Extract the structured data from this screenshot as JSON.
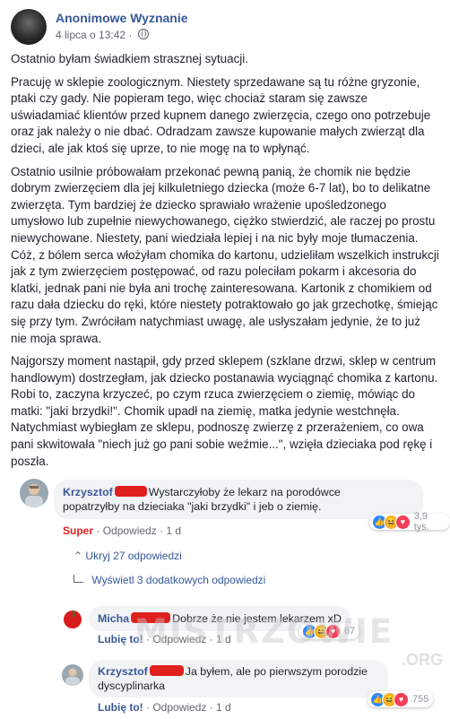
{
  "post": {
    "author": "Anonimowe Wyznanie",
    "date": "4 lipca o 13:42",
    "separator": "·",
    "paragraphs": [
      "Ostatnio byłam świadkiem strasznej sytuacji.",
      "Pracuję w sklepie zoologicznym. Niestety sprzedawane są tu różne gryzonie, ptaki czy gady. Nie popieram tego, więc chociaż staram się zawsze uświadamiać klientów przed kupnem danego zwierzęcia, czego ono potrzebuje oraz jak należy o nie dbać. Odradzam zawsze kupowanie małych zwierząt dla dzieci, ale jak ktoś się uprze, to nie mogę na to wpłynąć.",
      "Ostatnio usilnie próbowałam przekonać pewną panią, że chomik nie będzie dobrym zwierzęciem dla jej kilkuletniego dziecka (może 6-7 lat), bo to delikatne zwierzęta. Tym bardziej że dziecko sprawiało wrażenie upośledzonego umysłowo lub zupełnie niewychowanego, ciężko stwierdzić, ale raczej po prostu niewychowane. Niestety, pani wiedziała lepiej i na nic były moje tłumaczenia. Cóż, z bólem serca włożyłam chomika do kartonu, udzieliłam wszelkich instrukcji jak z tym zwierzęciem postępować, od razu poleciłam pokarm i akcesoria do klatki, jednak pani nie była ani trochę zainteresowana. Kartonik z chomikiem od razu dała dziecku do ręki, które niestety potraktowało go jak grzechotkę, śmiejąc się przy tym. Zwróciłam natychmiast uwagę, ale usłyszałam jedynie, że to już nie moja sprawa.",
      "Najgorszy moment nastąpił, gdy przed sklepem (szklane drzwi, sklep w centrum handlowym) dostrzegłam, jak dziecko postanawia wyciągnąć chomika z kartonu. Robi to, zaczyna krzyczeć, po czym rzuca zwierzęciem o ziemię, mówiąc do matki: \"jaki brzydki!\". Chomik upadł na ziemię, matka jedynie westchnęła. Natychmiast wybiegłam ze sklepu, podnoszę zwierzę z przerażeniem, co owa pani skwitowała \"niech już go pani sobie weźmie...\", wzięła dzieciaka pod rękę i poszła."
    ]
  },
  "comments": {
    "main": {
      "name": "Krzysztof",
      "text_line1": "Wystarczyłoby że lekarz na porodówce",
      "text_line2": "popatrzyłby na dzieciaka \"jaki brzydki\" i jeb o ziemię.",
      "reaction_label": "Super",
      "reply_label": "Odpowiedz",
      "time": "1 d",
      "reaction_count": "3,9 tys."
    },
    "hide_replies": "Ukryj 27 odpowiedzi",
    "show_more": "Wyświetl 3 dodatkowych odpowiedzi",
    "reply1": {
      "name": "Micha",
      "text": "Dobrze że nie jestem lekarzem xD",
      "like_label": "Lubię to!",
      "reply_label": "Odpowiedz",
      "time": "1 d",
      "reaction_count": "67"
    },
    "reply2": {
      "name": "Krzysztof",
      "text_line1": "Ja byłem, ale po pierwszym porodzie",
      "text_line2": "dyscyplinarka",
      "like_label": "Lubię to!",
      "reply_label": "Odpowiedz",
      "time": "1 d",
      "reaction_count": "755"
    }
  },
  "watermark": {
    "main": "MISTRZOWIE",
    "suffix": ".ORG"
  },
  "colors": {
    "link": "#385898",
    "redaction": "#e0201e",
    "bubble": "#f2f3f5"
  }
}
